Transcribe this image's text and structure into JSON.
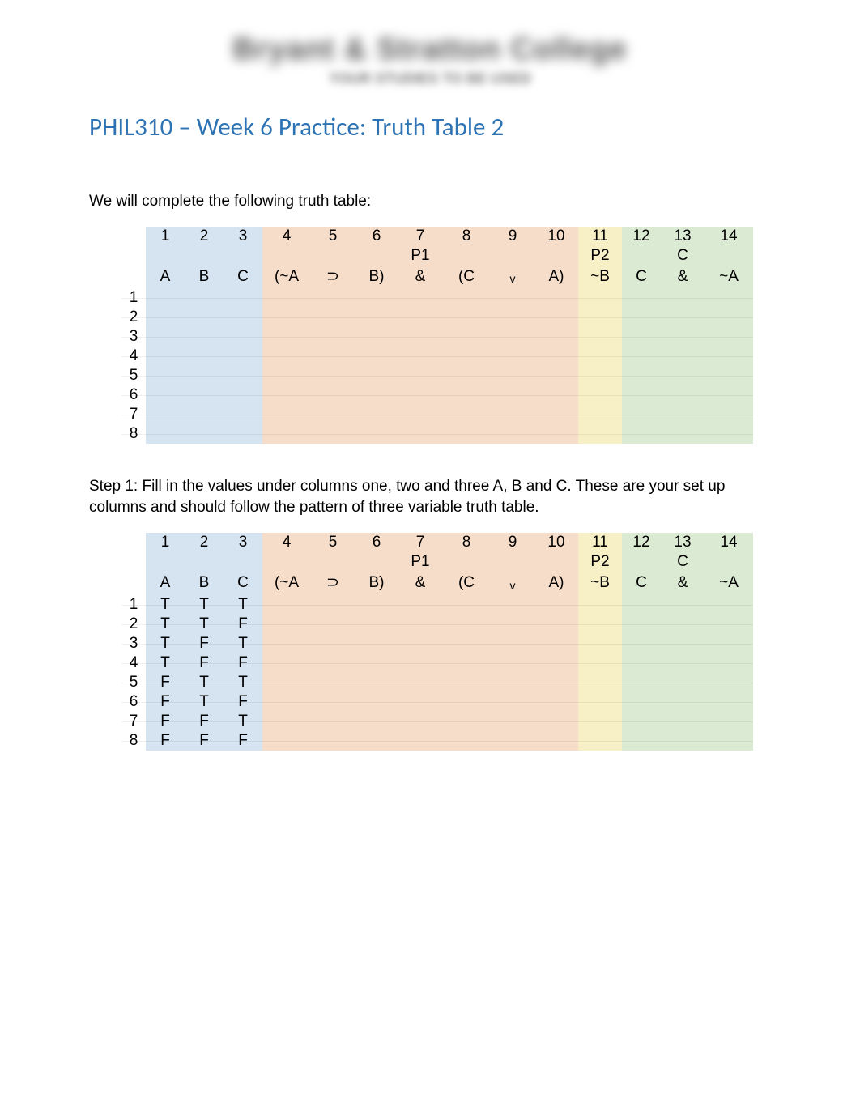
{
  "header": {
    "blur_line1": "Bryant & Stratton College",
    "blur_line2": "YOUR STUDIES TO BE USED"
  },
  "title": "PHIL310 – Week 6 Practice: Truth Table 2",
  "intro": "We will complete the following truth table:",
  "step1": "Step 1:  Fill in the values under columns one, two and three A, B and C.  These are your set up columns and should follow the pattern of three variable truth table.",
  "columns": {
    "nums": [
      "1",
      "2",
      "3",
      "4",
      "5",
      "6",
      "7",
      "8",
      "9",
      "10",
      "11",
      "12",
      "13",
      "14"
    ],
    "labels_row2": [
      "",
      "",
      "",
      "",
      "",
      "",
      "P1",
      "",
      "",
      "",
      "P2",
      "",
      "C",
      ""
    ],
    "vars": [
      "A",
      "B",
      "C",
      "(~A",
      "⊃",
      "B)",
      "&",
      "(C",
      "v",
      "A)",
      "~B",
      "C",
      "&",
      "~A"
    ]
  },
  "rows_blank": [
    "1",
    "2",
    "3",
    "4",
    "5",
    "6",
    "7",
    "8"
  ],
  "rows_filled": [
    {
      "n": "1",
      "a": "T",
      "b": "T",
      "c": "T"
    },
    {
      "n": "2",
      "a": "T",
      "b": "T",
      "c": "F"
    },
    {
      "n": "3",
      "a": "T",
      "b": "F",
      "c": "T"
    },
    {
      "n": "4",
      "a": "T",
      "b": "F",
      "c": "F"
    },
    {
      "n": "5",
      "a": "F",
      "b": "T",
      "c": "T"
    },
    {
      "n": "6",
      "a": "F",
      "b": "T",
      "c": "F"
    },
    {
      "n": "7",
      "a": "F",
      "b": "F",
      "c": "T"
    },
    {
      "n": "8",
      "a": "F",
      "b": "F",
      "c": "F"
    }
  ]
}
